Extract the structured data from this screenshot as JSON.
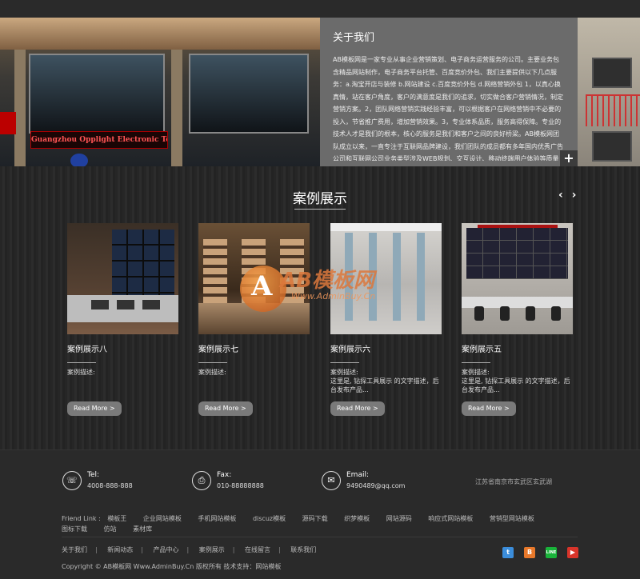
{
  "hero": {
    "sign_text": "Guangzhou Opplight Electronic Technology Co.,Ltd",
    "about_title": "关于我们",
    "about_text": "AB模板网是一家专业从事企业营销策划、电子商务运营服务的公司。主要业务包含精品网站制作，电子商务平台托管、百度竞价外包、我们主要提供以下几点服务：a.淘宝开店与装修 b.网站建设 c.百度竞价外包 d.网络营销外包 1，以真心换真情，站在客户角度，客户的满意度是我们的追求，切实做合客户营销情况，制定营销方案。2，团队网络营销实践经验丰富，可以根据客户在网络营销中不必要的投入，节省推广费用，增加营销效果。3，专业体系品质，服务高得保障。专业的技术人才是我们的根本，核心的服务是我们和客户之间的良好桥梁。AB模板网团队成立以来，一直专注于互联网品牌建设，我们团队的成员都有多年国内优秀广告公司和互联网公司业务类型涉及WEB规划、交互设计、移动终端用户体验等质量和信誉是我们存在的基石，我们注重客户。",
    "more_icon": "+"
  },
  "cases": {
    "title": "案例展示",
    "prev": "‹",
    "next": "›",
    "items": [
      {
        "name": "案例展示八",
        "desc": "案例描述:",
        "more": "Read More >"
      },
      {
        "name": "案例展示七",
        "desc": "案例描述:",
        "more": "Read More >"
      },
      {
        "name": "案例展示六",
        "desc": "案例描述:\n这里是, 钻探工具展示 的文字描述，后台发布产品...",
        "more": "Read More >"
      },
      {
        "name": "案例展示五",
        "desc": "案例描述:\n这里是, 钻探工具展示 的文字描述，后台发布产品...",
        "more": "Read More >"
      }
    ],
    "watermark_text": "AB模板网",
    "watermark_url": "Www.AdminBuy.Cn"
  },
  "footer": {
    "tel_label": "Tel:",
    "tel_value": "4008-888-888",
    "fax_label": "Fax:",
    "fax_value": "010-88888888",
    "email_label": "Email:",
    "email_value": "9490489@qq.com",
    "address": "江苏省南京市玄武区玄武湖",
    "friend_link_title": "Friend Link :",
    "friend_links": [
      "模板王",
      "企业网站模板",
      "手机网站模板",
      "discuz模板",
      "源码下载",
      "织梦模板",
      "网站源码",
      "响应式网站模板",
      "营销型网站模板",
      "图标下载",
      "仿站",
      "素材库"
    ],
    "nav": [
      "关于我们",
      "新闻动态",
      "产品中心",
      "案例展示",
      "在线留言",
      "联系我们"
    ],
    "copyright": "Copyright © AB模板网 Www.AdminBuy.Cn 版权所有 技术支持：网站模板"
  },
  "social": [
    {
      "name": "twitter",
      "glyph": "t",
      "color": "#3b8ddb"
    },
    {
      "name": "blogger",
      "glyph": "B",
      "color": "#e8782a"
    },
    {
      "name": "line",
      "glyph": "LINE",
      "color": "#19b33a"
    },
    {
      "name": "youtube",
      "glyph": "▶",
      "color": "#d8342a"
    }
  ]
}
